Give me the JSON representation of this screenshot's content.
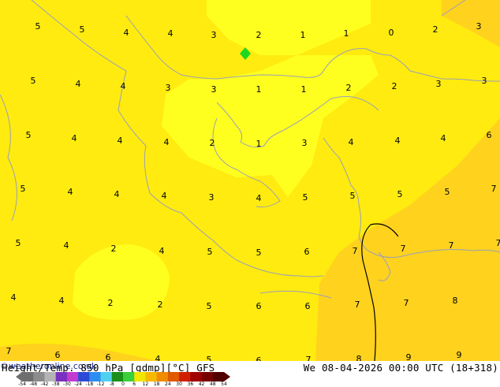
{
  "map": {
    "title": "Height/Temp. 850 hPa [gdmp][°C] GFS",
    "datetime": "We 08-04-2026 00:00 UTC (18+318)",
    "credit": "©weatheronline.co.uk",
    "values": [
      "5",
      "5",
      "4",
      "4",
      "3",
      "2",
      "1",
      "1",
      "0",
      "2",
      "3",
      "5",
      "4",
      "4",
      "3",
      "3",
      "1",
      "1",
      "2",
      "2",
      "3",
      "3",
      "5",
      "4",
      "4",
      "4",
      "2",
      "1",
      "3",
      "4",
      "4",
      "4",
      "6",
      "5",
      "4",
      "4",
      "4",
      "3",
      "4",
      "5",
      "5",
      "5",
      "5",
      "7",
      "5",
      "4",
      "2",
      "4",
      "5",
      "5",
      "6",
      "7",
      "7",
      "7",
      "7",
      "4",
      "4",
      "2",
      "2",
      "5",
      "6",
      "6",
      "7",
      "7",
      "8",
      "7",
      "6",
      "6",
      "4",
      "5",
      "6",
      "7",
      "8",
      "9",
      "9"
    ],
    "colorbar_ticks": [
      "-54",
      "-48",
      "-42",
      "-38",
      "-30",
      "-24",
      "-18",
      "-12",
      "-8",
      "0",
      "6",
      "12",
      "18",
      "24",
      "30",
      "36",
      "42",
      "48",
      "54"
    ],
    "colorbar_colors": [
      "#6e6e6e",
      "#8c8c8c",
      "#b4b4b4",
      "#7b2fbf",
      "#c13ccf",
      "#2b4bd6",
      "#2d8cf0",
      "#4fd0f0",
      "#1a8f1a",
      "#3ccf3c",
      "#f0e600",
      "#f7b800",
      "#f08c00",
      "#e05a00",
      "#d01e00",
      "#a00000",
      "#780000",
      "#500000"
    ],
    "colors": {
      "field_base": "#ffeb0f",
      "field_cool": "#ffff1f",
      "field_warm": "#ffd21e",
      "coast": "#9aa0b8",
      "boundary": "#000000",
      "marker": "#1ed81e"
    }
  }
}
